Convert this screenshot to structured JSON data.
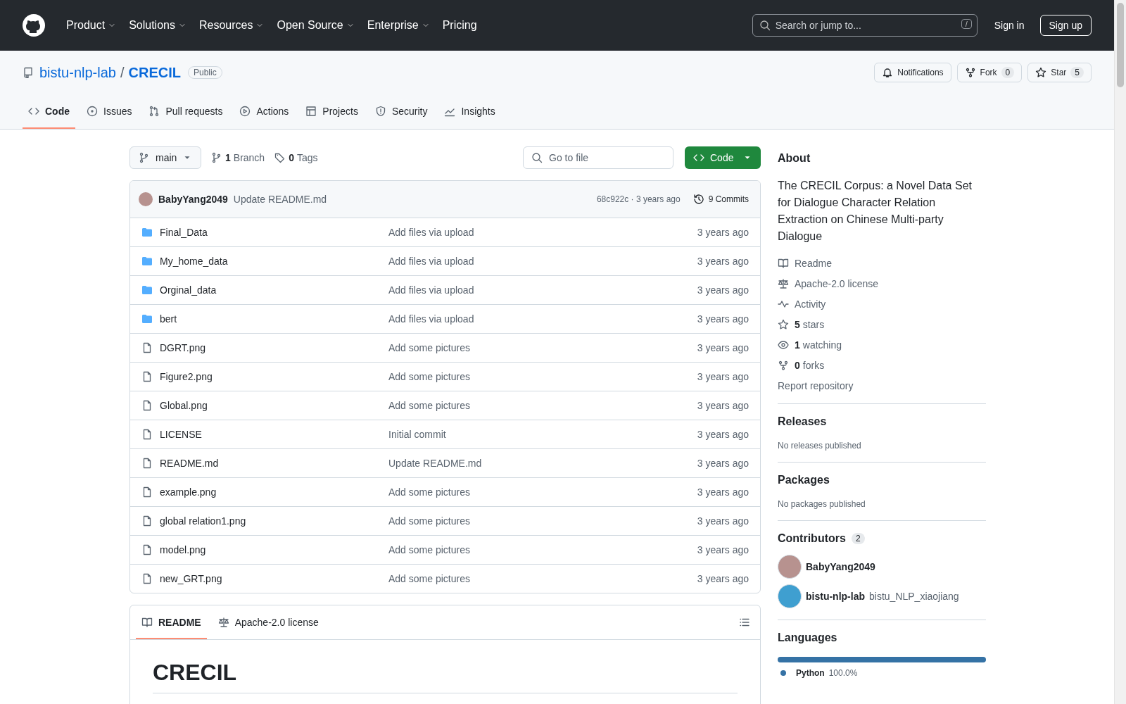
{
  "header": {
    "nav": [
      {
        "label": "Product",
        "has_menu": true
      },
      {
        "label": "Solutions",
        "has_menu": true
      },
      {
        "label": "Resources",
        "has_menu": true
      },
      {
        "label": "Open Source",
        "has_menu": true
      },
      {
        "label": "Enterprise",
        "has_menu": true
      },
      {
        "label": "Pricing",
        "has_menu": false
      }
    ],
    "search": {
      "placeholder": "Search or jump to...",
      "key": "/"
    },
    "sign_in": "Sign in",
    "sign_up": "Sign up"
  },
  "repo": {
    "owner": "bistu-nlp-lab",
    "separator": "/",
    "name": "CRECIL",
    "visibility": "Public",
    "actions": [
      {
        "kind": "notifications",
        "label": "Notifications"
      },
      {
        "kind": "fork",
        "label": "Fork",
        "count": "0"
      },
      {
        "kind": "star",
        "label": "Star",
        "count": "5"
      }
    ]
  },
  "tabs": [
    {
      "kind": "code",
      "label": "Code",
      "selected": true
    },
    {
      "kind": "issues",
      "label": "Issues",
      "selected": false
    },
    {
      "kind": "pull",
      "label": "Pull requests",
      "selected": false
    },
    {
      "kind": "actions",
      "label": "Actions",
      "selected": false
    },
    {
      "kind": "projects",
      "label": "Projects",
      "selected": false
    },
    {
      "kind": "security",
      "label": "Security",
      "selected": false
    },
    {
      "kind": "insights",
      "label": "Insights",
      "selected": false
    }
  ],
  "toolbar": {
    "branch": "main",
    "branches_count": "1",
    "branches_label": "Branch",
    "tags_count": "0",
    "tags_label": "Tags",
    "go_to_file": {
      "placeholder": "Go to file"
    },
    "code_button": "Code"
  },
  "latest_commit": {
    "author": "BabyYang2049",
    "message": "Update README.md",
    "hash_time": "68c922c · 3 years ago",
    "commits": "9 Commits"
  },
  "files": [
    {
      "kind": "folder",
      "name": "Final_Data",
      "message": "Add files via upload",
      "time": "3 years ago"
    },
    {
      "kind": "folder",
      "name": "My_home_data",
      "message": "Add files via upload",
      "time": "3 years ago"
    },
    {
      "kind": "folder",
      "name": "Orginal_data",
      "message": "Add files via upload",
      "time": "3 years ago"
    },
    {
      "kind": "folder",
      "name": "bert",
      "message": "Add files via upload",
      "time": "3 years ago"
    },
    {
      "kind": "file",
      "name": "DGRT.png",
      "message": "Add some pictures",
      "time": "3 years ago"
    },
    {
      "kind": "file",
      "name": "Figure2.png",
      "message": "Add some pictures",
      "time": "3 years ago"
    },
    {
      "kind": "file",
      "name": "Global.png",
      "message": "Add some pictures",
      "time": "3 years ago"
    },
    {
      "kind": "file",
      "name": "LICENSE",
      "message": "Initial commit",
      "time": "3 years ago"
    },
    {
      "kind": "file",
      "name": "README.md",
      "message": "Update README.md",
      "time": "3 years ago"
    },
    {
      "kind": "file",
      "name": "example.png",
      "message": "Add some pictures",
      "time": "3 years ago"
    },
    {
      "kind": "file",
      "name": "global relation1.png",
      "message": "Add some pictures",
      "time": "3 years ago"
    },
    {
      "kind": "file",
      "name": "model.png",
      "message": "Add some pictures",
      "time": "3 years ago"
    },
    {
      "kind": "file",
      "name": "new_GRT.png",
      "message": "Add some pictures",
      "time": "3 years ago"
    }
  ],
  "readme": {
    "tabs": [
      {
        "kind": "readme",
        "label": "README",
        "selected": true
      },
      {
        "kind": "law",
        "label": "Apache-2.0 license",
        "selected": false
      }
    ],
    "title": "CRECIL"
  },
  "sidebar": {
    "about": {
      "heading": "About",
      "description": "The CRECIL Corpus: a Novel Data Set for Dialogue Character Relation Extraction on Chinese Multi-party Dialogue",
      "links": [
        {
          "kind": "readme",
          "label": "Readme"
        },
        {
          "kind": "law",
          "label": "Apache-2.0 license"
        },
        {
          "kind": "activity",
          "label": "Activity"
        },
        {
          "kind": "star",
          "count": "5",
          "label": "stars"
        },
        {
          "kind": "eye",
          "count": "1",
          "label": "watching"
        },
        {
          "kind": "fork",
          "count": "0",
          "label": "forks"
        }
      ],
      "report": "Report repository"
    },
    "releases": {
      "heading": "Releases",
      "note": "No releases published"
    },
    "packages": {
      "heading": "Packages",
      "note": "No packages published"
    },
    "contributors": {
      "heading": "Contributors",
      "count": "2",
      "people": [
        {
          "name": "BabyYang2049",
          "color": "#b7928f"
        },
        {
          "name": "bistu-nlp-lab",
          "handle": "bistu_NLP_xiaojiang",
          "color": "#3f9fd0"
        }
      ]
    },
    "languages": {
      "heading": "Languages",
      "items": [
        {
          "name": "Python",
          "percent": "100.0%",
          "color": "#3572a5",
          "level": 1
        }
      ]
    }
  }
}
